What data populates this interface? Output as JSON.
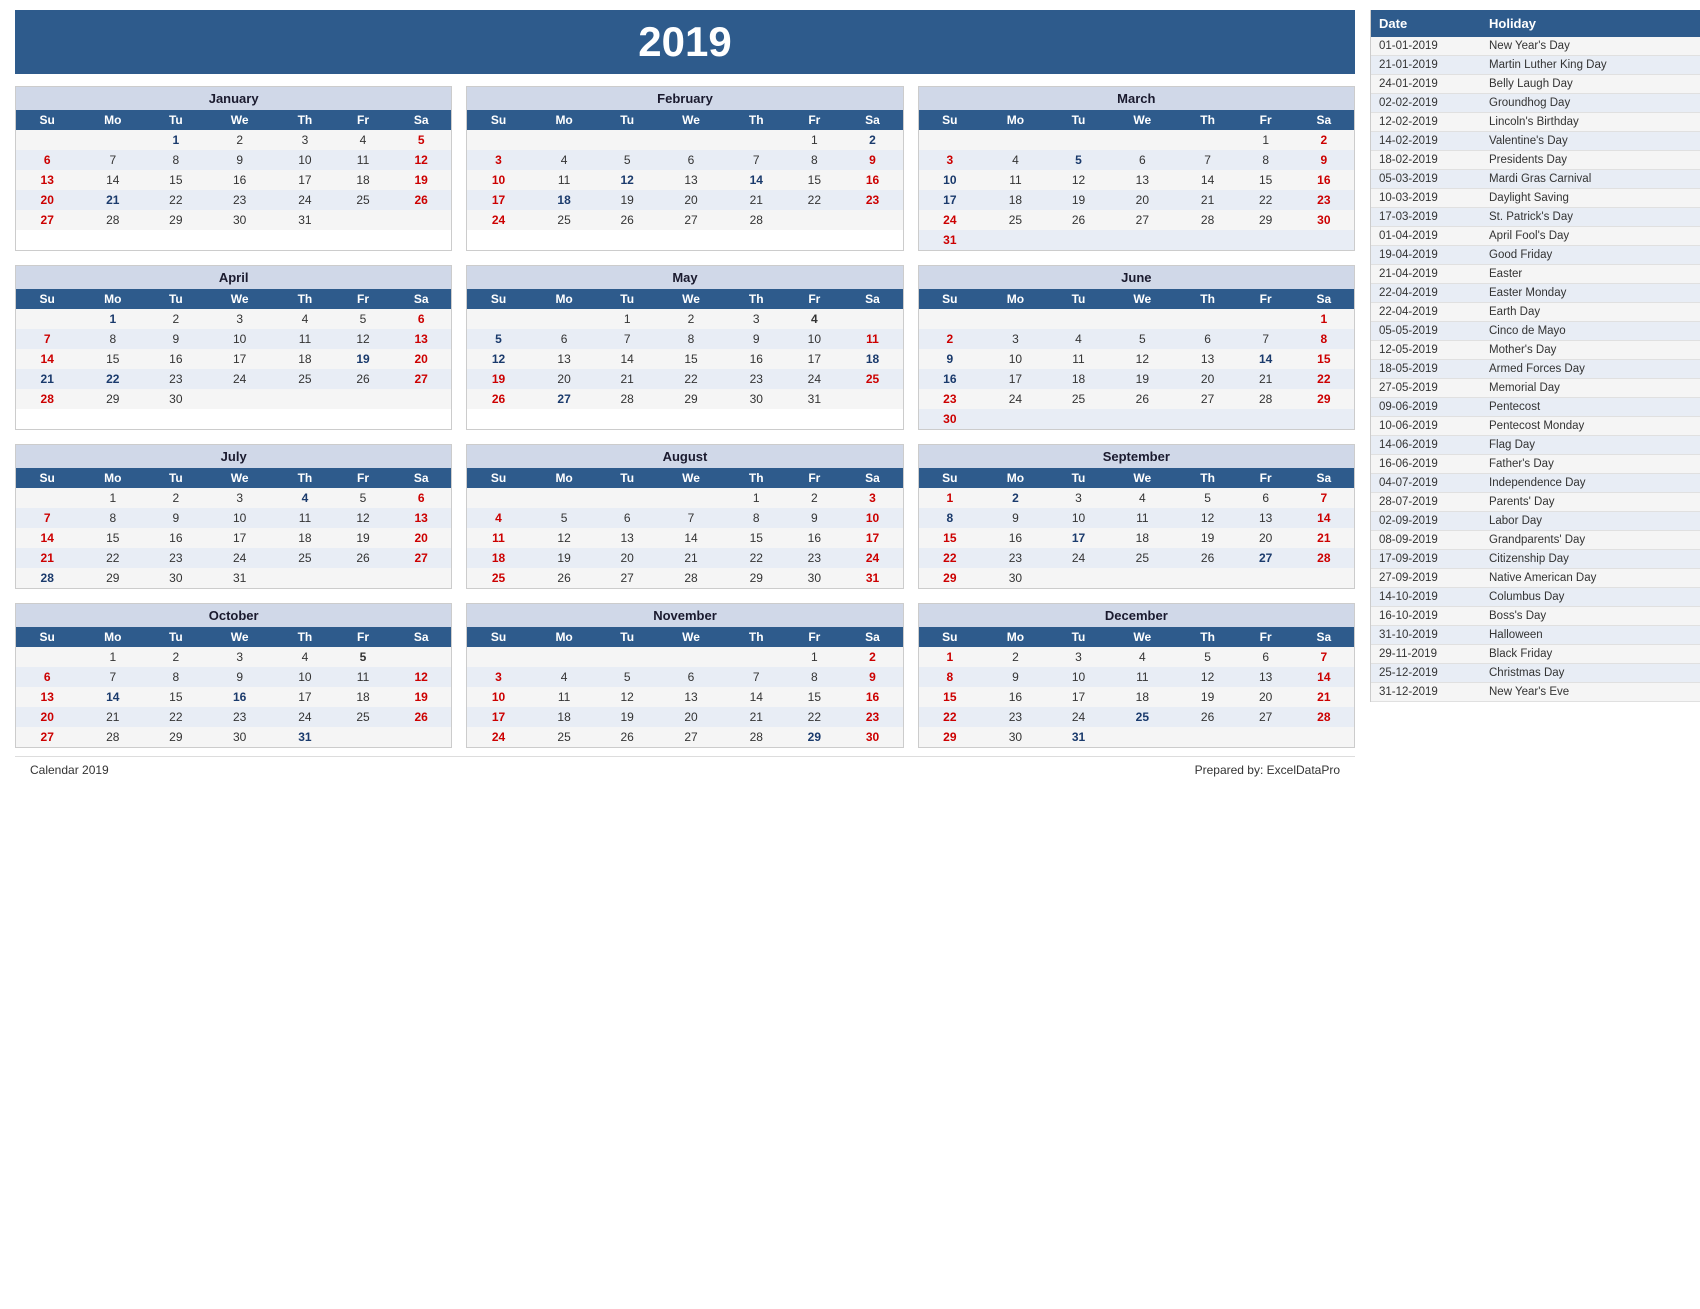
{
  "year": "2019",
  "footer_left": "Calendar 2019",
  "footer_right": "Prepared by: ExcelDataPro",
  "months": [
    {
      "name": "January",
      "days": [
        [
          "",
          "",
          "1",
          "2",
          "3",
          "4",
          "5"
        ],
        [
          "6",
          "7",
          "8",
          "9",
          "10",
          "11",
          "12"
        ],
        [
          "13",
          "14",
          "15",
          "16",
          "17",
          "18",
          "19"
        ],
        [
          "20",
          "21",
          "22",
          "23",
          "24",
          "25",
          "26"
        ],
        [
          "27",
          "28",
          "29",
          "30",
          "31",
          "",
          ""
        ]
      ],
      "bold": [
        "1",
        "5",
        "6",
        "12",
        "13",
        "19",
        "20",
        "21",
        "26",
        "27"
      ],
      "sat_bold": [
        "5",
        "12",
        "19",
        "26"
      ],
      "sun_bold": [
        "6",
        "13",
        "20",
        "27"
      ],
      "holiday_days": [
        "1",
        "21"
      ]
    },
    {
      "name": "February",
      "days": [
        [
          "",
          "",
          "",
          "",
          "",
          "1",
          "2"
        ],
        [
          "3",
          "4",
          "5",
          "6",
          "7",
          "8",
          "9"
        ],
        [
          "10",
          "11",
          "12",
          "13",
          "14",
          "15",
          "16"
        ],
        [
          "17",
          "18",
          "19",
          "20",
          "21",
          "22",
          "23"
        ],
        [
          "24",
          "25",
          "26",
          "27",
          "28",
          "",
          ""
        ]
      ],
      "bold": [
        "2",
        "3",
        "9",
        "10",
        "16",
        "17",
        "18",
        "23",
        "24"
      ],
      "sat_bold": [
        "2",
        "9",
        "16",
        "23"
      ],
      "sun_bold": [
        "3",
        "10",
        "17",
        "24"
      ],
      "holiday_days": [
        "2",
        "12",
        "14",
        "18"
      ]
    },
    {
      "name": "March",
      "days": [
        [
          "",
          "",
          "",
          "",
          "",
          "1",
          "2"
        ],
        [
          "3",
          "4",
          "5",
          "6",
          "7",
          "8",
          "9"
        ],
        [
          "10",
          "11",
          "12",
          "13",
          "14",
          "15",
          "16"
        ],
        [
          "17",
          "18",
          "19",
          "20",
          "21",
          "22",
          "23"
        ],
        [
          "24",
          "25",
          "26",
          "27",
          "28",
          "29",
          "30"
        ],
        [
          "31",
          "",
          "",
          "",
          "",
          "",
          ""
        ]
      ],
      "bold": [
        "2",
        "3",
        "9",
        "10",
        "16",
        "17",
        "23",
        "24",
        "30",
        "31"
      ],
      "sat_bold": [
        "2",
        "9",
        "16",
        "23",
        "30"
      ],
      "sun_bold": [
        "3",
        "10",
        "17",
        "24",
        "31"
      ],
      "holiday_days": [
        "5",
        "10",
        "17"
      ]
    },
    {
      "name": "April",
      "days": [
        [
          "",
          "1",
          "2",
          "3",
          "4",
          "5",
          "6"
        ],
        [
          "7",
          "8",
          "9",
          "10",
          "11",
          "12",
          "13"
        ],
        [
          "14",
          "15",
          "16",
          "17",
          "18",
          "19",
          "20"
        ],
        [
          "21",
          "22",
          "23",
          "24",
          "25",
          "26",
          "27"
        ],
        [
          "28",
          "29",
          "30",
          "",
          "",
          "",
          ""
        ]
      ],
      "bold": [
        "1",
        "6",
        "7",
        "13",
        "14",
        "20",
        "21",
        "22",
        "27",
        "28"
      ],
      "sat_bold": [
        "6",
        "13",
        "20",
        "27"
      ],
      "sun_bold": [
        "7",
        "14",
        "21",
        "28"
      ],
      "holiday_days": [
        "1",
        "19",
        "21",
        "22"
      ]
    },
    {
      "name": "May",
      "days": [
        [
          "",
          "",
          "1",
          "2",
          "3",
          "4",
          ""
        ],
        [
          "5",
          "6",
          "7",
          "8",
          "9",
          "10",
          "11"
        ],
        [
          "12",
          "13",
          "14",
          "15",
          "16",
          "17",
          "18"
        ],
        [
          "19",
          "20",
          "21",
          "22",
          "23",
          "24",
          "25"
        ],
        [
          "26",
          "27",
          "28",
          "29",
          "30",
          "31",
          ""
        ]
      ],
      "bold": [
        "4",
        "5",
        "11",
        "12",
        "18",
        "19",
        "25",
        "26"
      ],
      "sat_bold": [
        "4",
        "11",
        "18",
        "25"
      ],
      "sun_bold": [
        "5",
        "12",
        "19",
        "26"
      ],
      "holiday_days": [
        "5",
        "12",
        "18",
        "27"
      ]
    },
    {
      "name": "June",
      "days": [
        [
          "",
          "",
          "",
          "",
          "",
          "",
          "1"
        ],
        [
          "2",
          "3",
          "4",
          "5",
          "6",
          "7",
          "8"
        ],
        [
          "9",
          "10",
          "11",
          "12",
          "13",
          "14",
          "15"
        ],
        [
          "16",
          "17",
          "18",
          "19",
          "20",
          "21",
          "22"
        ],
        [
          "23",
          "24",
          "25",
          "26",
          "27",
          "28",
          "29"
        ],
        [
          "30",
          "",
          "",
          "",
          "",
          "",
          ""
        ]
      ],
      "bold": [
        "1",
        "2",
        "8",
        "9",
        "15",
        "16",
        "22",
        "23",
        "29",
        "30"
      ],
      "sat_bold": [
        "1",
        "8",
        "15",
        "22",
        "29"
      ],
      "sun_bold": [
        "2",
        "9",
        "16",
        "23",
        "30"
      ],
      "holiday_days": [
        "9",
        "14",
        "16"
      ]
    },
    {
      "name": "July",
      "days": [
        [
          "",
          "1",
          "2",
          "3",
          "4",
          "5",
          "6"
        ],
        [
          "7",
          "8",
          "9",
          "10",
          "11",
          "12",
          "13"
        ],
        [
          "14",
          "15",
          "16",
          "17",
          "18",
          "19",
          "20"
        ],
        [
          "21",
          "22",
          "23",
          "24",
          "25",
          "26",
          "27"
        ],
        [
          "28",
          "29",
          "30",
          "31",
          "",
          "",
          ""
        ]
      ],
      "bold": [
        "4",
        "6",
        "7",
        "13",
        "14",
        "20",
        "21",
        "27",
        "28"
      ],
      "sat_bold": [
        "6",
        "13",
        "20",
        "27"
      ],
      "sun_bold": [
        "7",
        "14",
        "21",
        "28"
      ],
      "holiday_days": [
        "4",
        "28"
      ]
    },
    {
      "name": "August",
      "days": [
        [
          "",
          "",
          "",
          "",
          "1",
          "2",
          "3"
        ],
        [
          "4",
          "5",
          "6",
          "7",
          "8",
          "9",
          "10"
        ],
        [
          "11",
          "12",
          "13",
          "14",
          "15",
          "16",
          "17"
        ],
        [
          "18",
          "19",
          "20",
          "21",
          "22",
          "23",
          "24"
        ],
        [
          "25",
          "26",
          "27",
          "28",
          "29",
          "30",
          "31"
        ]
      ],
      "bold": [
        "3",
        "4",
        "10",
        "11",
        "17",
        "18",
        "24",
        "25",
        "31"
      ],
      "sat_bold": [
        "3",
        "10",
        "17",
        "24",
        "31"
      ],
      "sun_bold": [
        "4",
        "11",
        "18",
        "25"
      ],
      "holiday_days": []
    },
    {
      "name": "September",
      "days": [
        [
          "1",
          "2",
          "3",
          "4",
          "5",
          "6",
          "7"
        ],
        [
          "8",
          "9",
          "10",
          "11",
          "12",
          "13",
          "14"
        ],
        [
          "15",
          "16",
          "17",
          "18",
          "19",
          "20",
          "21"
        ],
        [
          "22",
          "23",
          "24",
          "25",
          "26",
          "27",
          "28"
        ],
        [
          "29",
          "30",
          "",
          "",
          "",
          "",
          ""
        ]
      ],
      "bold": [
        "1",
        "7",
        "8",
        "14",
        "15",
        "21",
        "22",
        "27",
        "28",
        "29"
      ],
      "sat_bold": [
        "7",
        "14",
        "21",
        "28"
      ],
      "sun_bold": [
        "1",
        "8",
        "15",
        "22",
        "29"
      ],
      "holiday_days": [
        "2",
        "8",
        "17",
        "27"
      ]
    },
    {
      "name": "October",
      "days": [
        [
          "",
          "1",
          "2",
          "3",
          "4",
          "5",
          ""
        ],
        [
          "6",
          "7",
          "8",
          "9",
          "10",
          "11",
          "12"
        ],
        [
          "13",
          "14",
          "15",
          "16",
          "17",
          "18",
          "19"
        ],
        [
          "20",
          "21",
          "22",
          "23",
          "24",
          "25",
          "26"
        ],
        [
          "27",
          "28",
          "29",
          "30",
          "31",
          "",
          ""
        ]
      ],
      "bold": [
        "5",
        "6",
        "12",
        "13",
        "19",
        "20",
        "26",
        "27",
        "31"
      ],
      "sat_bold": [
        "5",
        "12",
        "19",
        "26"
      ],
      "sun_bold": [
        "6",
        "13",
        "20",
        "27"
      ],
      "holiday_days": [
        "14",
        "16",
        "31"
      ]
    },
    {
      "name": "November",
      "days": [
        [
          "",
          "",
          "",
          "",
          "",
          "1",
          "2"
        ],
        [
          "3",
          "4",
          "5",
          "6",
          "7",
          "8",
          "9"
        ],
        [
          "10",
          "11",
          "12",
          "13",
          "14",
          "15",
          "16"
        ],
        [
          "17",
          "18",
          "19",
          "20",
          "21",
          "22",
          "23"
        ],
        [
          "24",
          "25",
          "26",
          "27",
          "28",
          "29",
          "30"
        ]
      ],
      "bold": [
        "2",
        "3",
        "9",
        "10",
        "16",
        "17",
        "23",
        "24",
        "29",
        "30"
      ],
      "sat_bold": [
        "2",
        "9",
        "16",
        "23",
        "30"
      ],
      "sun_bold": [
        "3",
        "10",
        "17",
        "24"
      ],
      "holiday_days": [
        "29"
      ]
    },
    {
      "name": "December",
      "days": [
        [
          "1",
          "2",
          "3",
          "4",
          "5",
          "6",
          "7"
        ],
        [
          "8",
          "9",
          "10",
          "11",
          "12",
          "13",
          "14"
        ],
        [
          "15",
          "16",
          "17",
          "18",
          "19",
          "20",
          "21"
        ],
        [
          "22",
          "23",
          "24",
          "25",
          "26",
          "27",
          "28"
        ],
        [
          "29",
          "30",
          "31",
          "",
          "",
          "",
          ""
        ]
      ],
      "bold": [
        "1",
        "7",
        "8",
        "14",
        "15",
        "21",
        "22",
        "25",
        "28",
        "29"
      ],
      "sat_bold": [
        "7",
        "14",
        "21",
        "28"
      ],
      "sun_bold": [
        "1",
        "8",
        "15",
        "22",
        "29"
      ],
      "holiday_days": [
        "25",
        "31"
      ]
    }
  ],
  "weekdays": [
    "Su",
    "Mo",
    "Tu",
    "We",
    "Th",
    "Fr",
    "Sa"
  ],
  "holidays": [
    {
      "date": "01-01-2019",
      "name": "New Year's Day"
    },
    {
      "date": "21-01-2019",
      "name": "Martin Luther King Day"
    },
    {
      "date": "24-01-2019",
      "name": "Belly Laugh Day"
    },
    {
      "date": "02-02-2019",
      "name": "Groundhog Day"
    },
    {
      "date": "12-02-2019",
      "name": "Lincoln's Birthday"
    },
    {
      "date": "14-02-2019",
      "name": "Valentine's Day"
    },
    {
      "date": "18-02-2019",
      "name": "Presidents Day"
    },
    {
      "date": "05-03-2019",
      "name": "Mardi Gras Carnival"
    },
    {
      "date": "10-03-2019",
      "name": "Daylight Saving"
    },
    {
      "date": "17-03-2019",
      "name": "St. Patrick's Day"
    },
    {
      "date": "01-04-2019",
      "name": "April Fool's Day"
    },
    {
      "date": "19-04-2019",
      "name": "Good Friday"
    },
    {
      "date": "21-04-2019",
      "name": "Easter"
    },
    {
      "date": "22-04-2019",
      "name": "Easter Monday"
    },
    {
      "date": "22-04-2019",
      "name": "Earth Day"
    },
    {
      "date": "05-05-2019",
      "name": "Cinco de Mayo"
    },
    {
      "date": "12-05-2019",
      "name": "Mother's Day"
    },
    {
      "date": "18-05-2019",
      "name": "Armed Forces Day"
    },
    {
      "date": "27-05-2019",
      "name": "Memorial Day"
    },
    {
      "date": "09-06-2019",
      "name": "Pentecost"
    },
    {
      "date": "10-06-2019",
      "name": "Pentecost Monday"
    },
    {
      "date": "14-06-2019",
      "name": "Flag Day"
    },
    {
      "date": "16-06-2019",
      "name": "Father's Day"
    },
    {
      "date": "04-07-2019",
      "name": "Independence Day"
    },
    {
      "date": "28-07-2019",
      "name": "Parents' Day"
    },
    {
      "date": "02-09-2019",
      "name": "Labor Day"
    },
    {
      "date": "08-09-2019",
      "name": "Grandparents' Day"
    },
    {
      "date": "17-09-2019",
      "name": "Citizenship Day"
    },
    {
      "date": "27-09-2019",
      "name": "Native American Day"
    },
    {
      "date": "14-10-2019",
      "name": "Columbus Day"
    },
    {
      "date": "16-10-2019",
      "name": "Boss's Day"
    },
    {
      "date": "31-10-2019",
      "name": "Halloween"
    },
    {
      "date": "29-11-2019",
      "name": "Black Friday"
    },
    {
      "date": "25-12-2019",
      "name": "Christmas Day"
    },
    {
      "date": "31-12-2019",
      "name": "New Year's Eve"
    }
  ]
}
